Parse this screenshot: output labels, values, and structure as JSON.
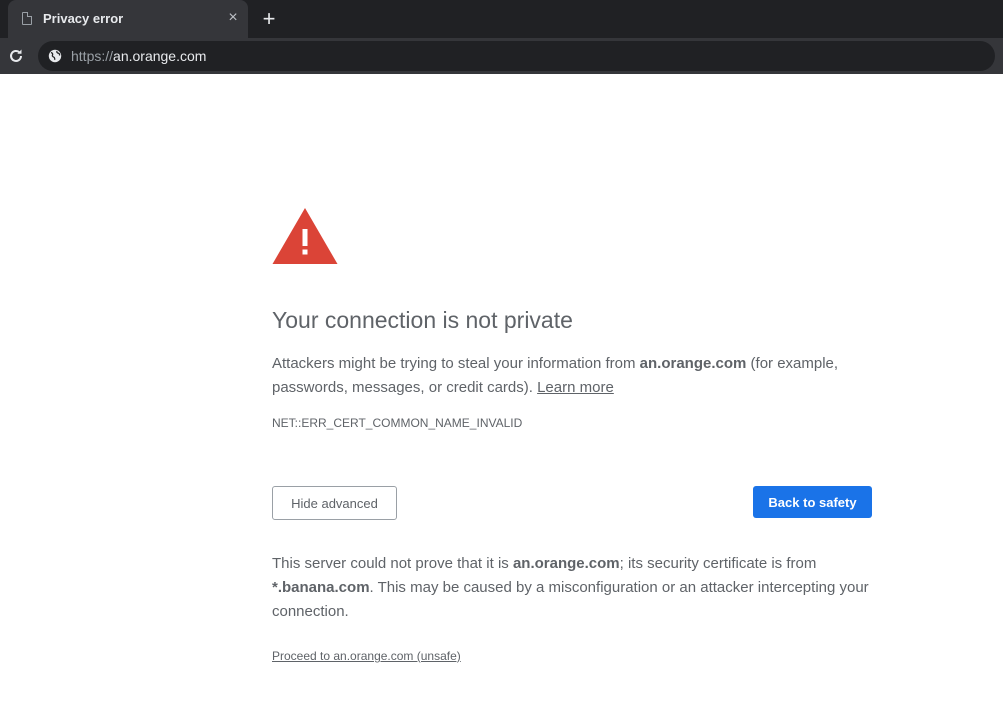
{
  "tab": {
    "title": "Privacy error",
    "close_glyph": "×",
    "new_tab_glyph": "+",
    "icons": {
      "favicon": "page-icon",
      "close": "close-icon",
      "new_tab": "plus-icon"
    }
  },
  "toolbar": {
    "url_scheme": "https://",
    "url_host": "an.orange.com",
    "icons": {
      "reload": "reload-icon",
      "site_info": "globe-icon"
    }
  },
  "page": {
    "heading": "Your connection is not private",
    "explanation": {
      "prefix": "Attackers might be trying to steal your information from ",
      "host": "an.orange.com",
      "suffix": " (for example, passwords, messages, or credit cards). ",
      "learn_more": "Learn more"
    },
    "error_code": "NET::ERR_CERT_COMMON_NAME_INVALID",
    "hide_advanced_label": "Hide advanced",
    "back_to_safety_label": "Back to safety",
    "details": {
      "part1": "This server could not prove that it is ",
      "host": "an.orange.com",
      "part2": "; its security certificate is from ",
      "cert_host": "*.banana.com",
      "part3": ". This may be caused by a misconfiguration or an attacker intercepting your connection."
    },
    "proceed_link": "Proceed to an.orange.com (unsafe)",
    "icons": {
      "warning": "warning-triangle-icon"
    }
  },
  "colors": {
    "chrome_dark": "#202124",
    "chrome_tab": "#35363a",
    "text_gray": "#5f6368",
    "primary_button": "#1a73e8",
    "warning_red": "#db4437"
  }
}
